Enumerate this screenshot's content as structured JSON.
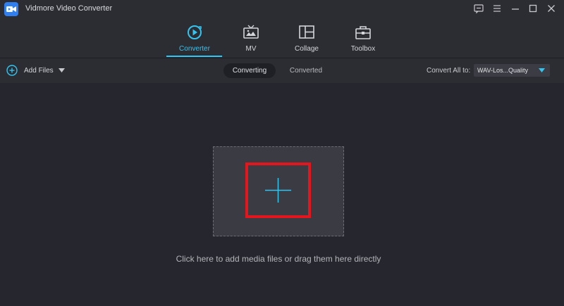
{
  "app": {
    "title": "Vidmore Video Converter",
    "logo_icon": "camera-icon"
  },
  "window_controls": [
    {
      "name": "feedback-icon"
    },
    {
      "name": "menu-icon"
    },
    {
      "name": "minimize-icon"
    },
    {
      "name": "maximize-icon"
    },
    {
      "name": "close-icon"
    }
  ],
  "nav": {
    "tabs": [
      {
        "label": "Converter",
        "icon": "converter-icon",
        "active": true
      },
      {
        "label": "MV",
        "icon": "tv-icon",
        "active": false
      },
      {
        "label": "Collage",
        "icon": "collage-icon",
        "active": false
      },
      {
        "label": "Toolbox",
        "icon": "toolbox-icon",
        "active": false
      }
    ]
  },
  "toolbar": {
    "add_files": "Add Files",
    "status_tabs": {
      "converting": "Converting",
      "converted": "Converted"
    },
    "convert_all_label": "Convert All to:",
    "format_value": "WAV-Los...Quality"
  },
  "dropzone": {
    "hint": "Click here to add media files or drag them here directly"
  },
  "colors": {
    "accent": "#33c4f0",
    "highlight": "#e3161e",
    "background": "#26272e",
    "panel": "#2c2d33"
  }
}
